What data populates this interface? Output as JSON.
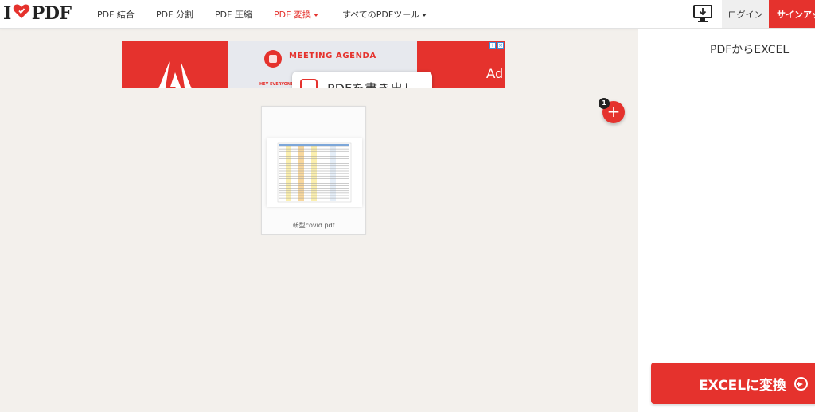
{
  "header": {
    "logo_prefix": "I",
    "logo_suffix": "PDF",
    "nav": [
      {
        "label": "PDF 結合"
      },
      {
        "label": "PDF 分割"
      },
      {
        "label": "PDF 圧縮"
      },
      {
        "label": "PDF 変換"
      },
      {
        "label": "すべてのPDFツール"
      }
    ],
    "login_label": "ログイン",
    "signup_label": "サインアップ"
  },
  "ad": {
    "agenda_text": "MEETING AGENDA",
    "small_text": "HEY EVERYONE",
    "popup_text": "PDFを書き出し",
    "brand_text": "Ad"
  },
  "file": {
    "name": "新型covid.pdf"
  },
  "add_button": {
    "icon": "plus-icon",
    "count": "1"
  },
  "sidebar": {
    "title": "PDFからEXCEL",
    "convert_label": "EXCELに変換"
  },
  "colors": {
    "brand": "#e5322d",
    "background": "#f3f0ec"
  }
}
